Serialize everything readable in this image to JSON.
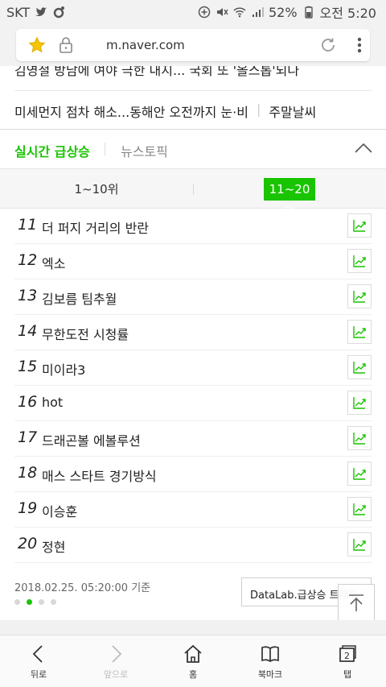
{
  "status_bar": {
    "carrier": "SKT",
    "battery": "52%",
    "time": "오전 5:20"
  },
  "browser": {
    "url": "m.naver.com"
  },
  "news": {
    "headline1": "김영철 방남에 여야 극한 내지... 국회 또 '올스톱'되나",
    "headline2": "미세먼지 점차 해소...동해안 오전까지 눈·비",
    "headline2_extra": "주말날씨"
  },
  "section_tabs": {
    "realtime": "실시간 급상승",
    "news_topic": "뉴스토픽"
  },
  "rank_toggle": {
    "range_a": "1~10위",
    "range_b": "11~20위"
  },
  "rank_list": [
    {
      "rank": "11",
      "keyword": "더 퍼지 거리의 반란"
    },
    {
      "rank": "12",
      "keyword": "엑소"
    },
    {
      "rank": "13",
      "keyword": "김보름 팀추월"
    },
    {
      "rank": "14",
      "keyword": "무한도전 시청률"
    },
    {
      "rank": "15",
      "keyword": "미이라3"
    },
    {
      "rank": "16",
      "keyword": "hot"
    },
    {
      "rank": "17",
      "keyword": "드래곤볼 에볼루션"
    },
    {
      "rank": "18",
      "keyword": "매스 스타트 경기방식"
    },
    {
      "rank": "19",
      "keyword": "이승훈"
    },
    {
      "rank": "20",
      "keyword": "정현"
    }
  ],
  "footer": {
    "timestamp": "2018.02.25. 05:20:00 기준",
    "datalab_label": "DataLab.급상승 트래픽",
    "active_page": 2,
    "total_pages": 4
  },
  "bottom_nav": {
    "back": "뒤로",
    "forward": "앞으로",
    "home": "홈",
    "bookmarks": "북마크",
    "tabs": "탭",
    "tab_count": "2"
  },
  "colors": {
    "accent": "#19c400"
  }
}
